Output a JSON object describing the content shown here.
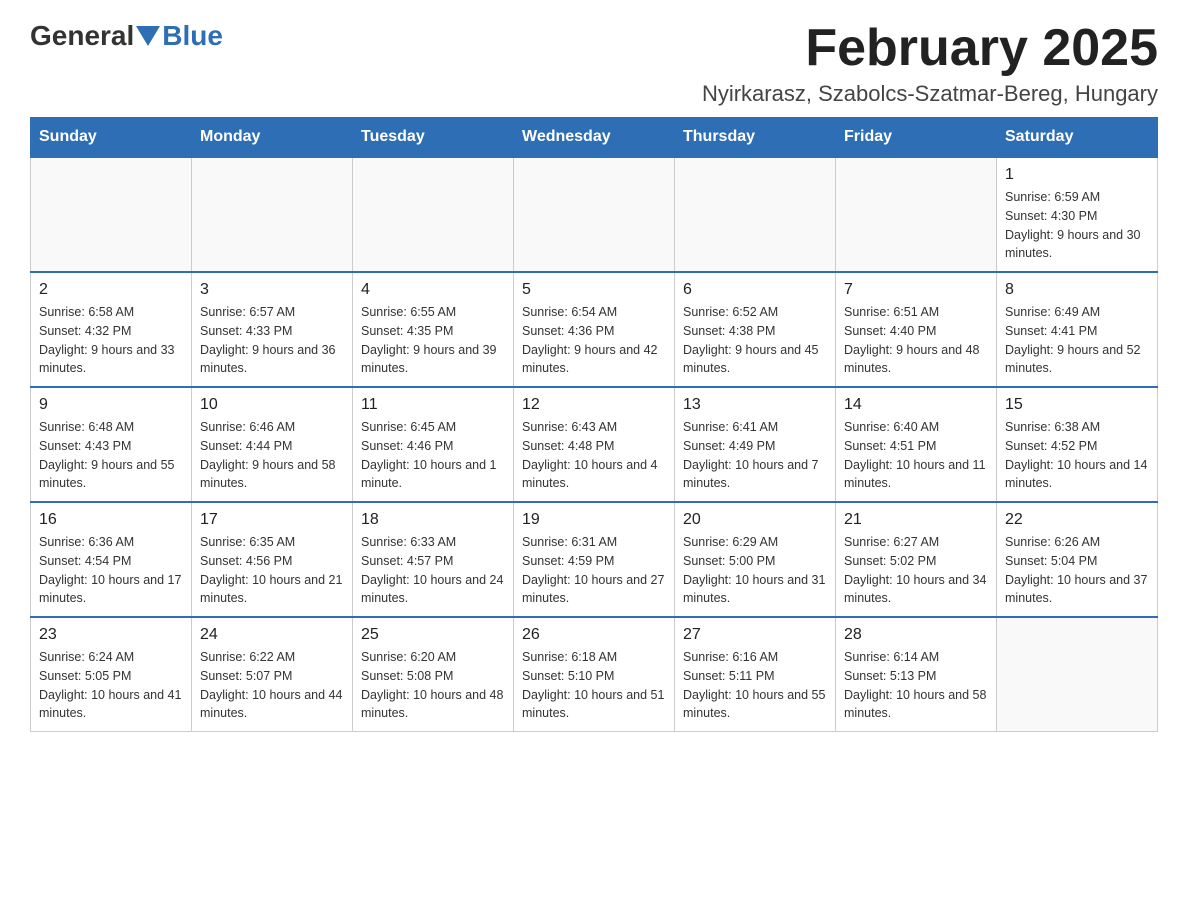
{
  "logo": {
    "general": "General",
    "blue": "Blue"
  },
  "title": "February 2025",
  "location": "Nyirkarasz, Szabolcs-Szatmar-Bereg, Hungary",
  "weekdays": [
    "Sunday",
    "Monday",
    "Tuesday",
    "Wednesday",
    "Thursday",
    "Friday",
    "Saturday"
  ],
  "weeks": [
    [
      {
        "day": "",
        "info": ""
      },
      {
        "day": "",
        "info": ""
      },
      {
        "day": "",
        "info": ""
      },
      {
        "day": "",
        "info": ""
      },
      {
        "day": "",
        "info": ""
      },
      {
        "day": "",
        "info": ""
      },
      {
        "day": "1",
        "info": "Sunrise: 6:59 AM\nSunset: 4:30 PM\nDaylight: 9 hours and 30 minutes."
      }
    ],
    [
      {
        "day": "2",
        "info": "Sunrise: 6:58 AM\nSunset: 4:32 PM\nDaylight: 9 hours and 33 minutes."
      },
      {
        "day": "3",
        "info": "Sunrise: 6:57 AM\nSunset: 4:33 PM\nDaylight: 9 hours and 36 minutes."
      },
      {
        "day": "4",
        "info": "Sunrise: 6:55 AM\nSunset: 4:35 PM\nDaylight: 9 hours and 39 minutes."
      },
      {
        "day": "5",
        "info": "Sunrise: 6:54 AM\nSunset: 4:36 PM\nDaylight: 9 hours and 42 minutes."
      },
      {
        "day": "6",
        "info": "Sunrise: 6:52 AM\nSunset: 4:38 PM\nDaylight: 9 hours and 45 minutes."
      },
      {
        "day": "7",
        "info": "Sunrise: 6:51 AM\nSunset: 4:40 PM\nDaylight: 9 hours and 48 minutes."
      },
      {
        "day": "8",
        "info": "Sunrise: 6:49 AM\nSunset: 4:41 PM\nDaylight: 9 hours and 52 minutes."
      }
    ],
    [
      {
        "day": "9",
        "info": "Sunrise: 6:48 AM\nSunset: 4:43 PM\nDaylight: 9 hours and 55 minutes."
      },
      {
        "day": "10",
        "info": "Sunrise: 6:46 AM\nSunset: 4:44 PM\nDaylight: 9 hours and 58 minutes."
      },
      {
        "day": "11",
        "info": "Sunrise: 6:45 AM\nSunset: 4:46 PM\nDaylight: 10 hours and 1 minute."
      },
      {
        "day": "12",
        "info": "Sunrise: 6:43 AM\nSunset: 4:48 PM\nDaylight: 10 hours and 4 minutes."
      },
      {
        "day": "13",
        "info": "Sunrise: 6:41 AM\nSunset: 4:49 PM\nDaylight: 10 hours and 7 minutes."
      },
      {
        "day": "14",
        "info": "Sunrise: 6:40 AM\nSunset: 4:51 PM\nDaylight: 10 hours and 11 minutes."
      },
      {
        "day": "15",
        "info": "Sunrise: 6:38 AM\nSunset: 4:52 PM\nDaylight: 10 hours and 14 minutes."
      }
    ],
    [
      {
        "day": "16",
        "info": "Sunrise: 6:36 AM\nSunset: 4:54 PM\nDaylight: 10 hours and 17 minutes."
      },
      {
        "day": "17",
        "info": "Sunrise: 6:35 AM\nSunset: 4:56 PM\nDaylight: 10 hours and 21 minutes."
      },
      {
        "day": "18",
        "info": "Sunrise: 6:33 AM\nSunset: 4:57 PM\nDaylight: 10 hours and 24 minutes."
      },
      {
        "day": "19",
        "info": "Sunrise: 6:31 AM\nSunset: 4:59 PM\nDaylight: 10 hours and 27 minutes."
      },
      {
        "day": "20",
        "info": "Sunrise: 6:29 AM\nSunset: 5:00 PM\nDaylight: 10 hours and 31 minutes."
      },
      {
        "day": "21",
        "info": "Sunrise: 6:27 AM\nSunset: 5:02 PM\nDaylight: 10 hours and 34 minutes."
      },
      {
        "day": "22",
        "info": "Sunrise: 6:26 AM\nSunset: 5:04 PM\nDaylight: 10 hours and 37 minutes."
      }
    ],
    [
      {
        "day": "23",
        "info": "Sunrise: 6:24 AM\nSunset: 5:05 PM\nDaylight: 10 hours and 41 minutes."
      },
      {
        "day": "24",
        "info": "Sunrise: 6:22 AM\nSunset: 5:07 PM\nDaylight: 10 hours and 44 minutes."
      },
      {
        "day": "25",
        "info": "Sunrise: 6:20 AM\nSunset: 5:08 PM\nDaylight: 10 hours and 48 minutes."
      },
      {
        "day": "26",
        "info": "Sunrise: 6:18 AM\nSunset: 5:10 PM\nDaylight: 10 hours and 51 minutes."
      },
      {
        "day": "27",
        "info": "Sunrise: 6:16 AM\nSunset: 5:11 PM\nDaylight: 10 hours and 55 minutes."
      },
      {
        "day": "28",
        "info": "Sunrise: 6:14 AM\nSunset: 5:13 PM\nDaylight: 10 hours and 58 minutes."
      },
      {
        "day": "",
        "info": ""
      }
    ]
  ]
}
